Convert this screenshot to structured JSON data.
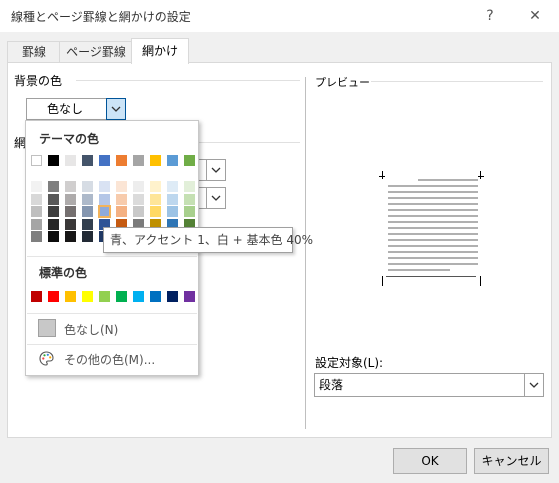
{
  "window": {
    "title": "線種とページ罫線と網かけの設定",
    "help_label": "?",
    "close_label": "✕"
  },
  "tabs": [
    {
      "label": "罫線"
    },
    {
      "label": "ページ罫線"
    },
    {
      "label": "網かけ",
      "active": true
    }
  ],
  "background": {
    "section_label": "背景の色",
    "combo_value": "色なし"
  },
  "pattern": {
    "section_label_partial": "網"
  },
  "preview": {
    "section_label": "プレビュー"
  },
  "apply_to": {
    "label": "設定対象(L):",
    "value": "段落"
  },
  "color_picker": {
    "theme_header": "テーマの色",
    "standard_header": "標準の色",
    "no_color_label": "色なし(N)",
    "more_colors_label": "その他の色(M)...",
    "theme_top_row": [
      "#ffffff",
      "#000000",
      "#e7e6e6",
      "#44546a",
      "#4472c4",
      "#ed7d31",
      "#a5a5a5",
      "#ffc000",
      "#5b9bd5",
      "#70ad47"
    ],
    "theme_shades": [
      [
        "#f2f2f2",
        "#7f7f7f",
        "#d0cece",
        "#d6dce4",
        "#d9e2f3",
        "#fbe5d5",
        "#ededed",
        "#fff2cc",
        "#deebf6",
        "#e2efd9"
      ],
      [
        "#d8d8d8",
        "#595959",
        "#aeabab",
        "#adb9ca",
        "#b4c6e7",
        "#f7cbac",
        "#dbdbdb",
        "#fee599",
        "#bdd7ee",
        "#c5e0b3"
      ],
      [
        "#bfbfbf",
        "#3f3f3f",
        "#757070",
        "#8496b0",
        "#8eaadb",
        "#f4b183",
        "#c9c9c9",
        "#ffd965",
        "#9cc3e5",
        "#a8d08d"
      ],
      [
        "#a5a5a5",
        "#262626",
        "#3a3838",
        "#323f4f",
        "#2f5496",
        "#c55a11",
        "#7b7b7b",
        "#bf9000",
        "#2e75b5",
        "#538135"
      ],
      [
        "#7f7f7f",
        "#0c0c0c",
        "#171616",
        "#222a35",
        "#1f3864",
        "#833c0b",
        "#525252",
        "#7f6000",
        "#1e4e79",
        "#375623"
      ]
    ],
    "standard_colors": [
      "#c00000",
      "#ff0000",
      "#ffc000",
      "#ffff00",
      "#92d050",
      "#00b050",
      "#00b0f0",
      "#0070c0",
      "#002060",
      "#7030a0"
    ],
    "no_color_swatch": "#c8c8c8",
    "selected": {
      "row": 2,
      "col": 4
    },
    "palette_icon": "palette-icon"
  },
  "tooltip": "青、アクセント 1、白 + 基本色 40%",
  "buttons": {
    "ok": "OK",
    "cancel": "キャンセル"
  }
}
